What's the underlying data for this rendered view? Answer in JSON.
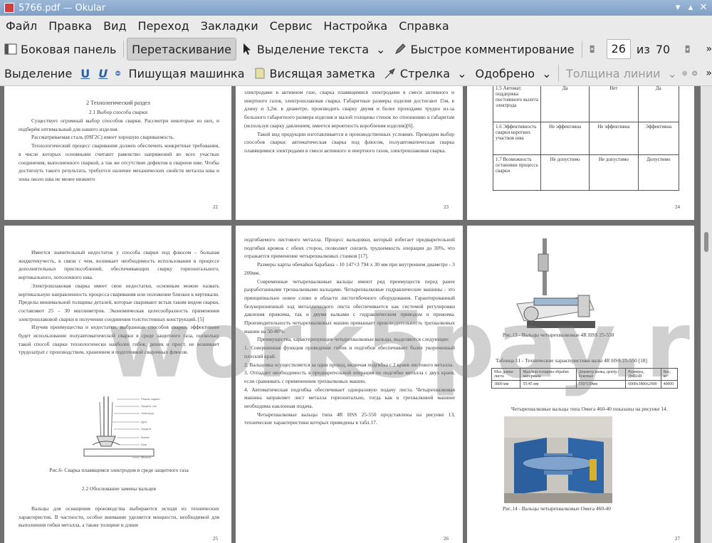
{
  "window": {
    "title": "5766.pdf  — Okular"
  },
  "menu": [
    "Файл",
    "Правка",
    "Вид",
    "Переход",
    "Закладки",
    "Сервис",
    "Настройка",
    "Справка"
  ],
  "toolbar1": {
    "sidebar": "Боковая панель",
    "drag": "Перетаскивание",
    "text_select": "Выделение текста",
    "quick_comment": "Быстрое комментирование",
    "current_page": "26",
    "of_label": "из",
    "total_pages": "70"
  },
  "toolbar2": {
    "highlight": "Выделение",
    "typewriter": "Пишущая машинка",
    "sticky_note": "Висящая заметка",
    "arrow": "Стрелка",
    "approved": "Одобрено",
    "line_width": "Толщина линии"
  },
  "watermark": "work5pay.ru",
  "pages": {
    "p22": {
      "number": "22",
      "heading": "2 Технологический раздел",
      "subheading": "2.1 Выбор способа сварки",
      "paragraphs": [
        "Существует огромный выбор способов сварки. Рассмотри некоторые из них, и подберём оптимальный для нашего изделия.",
        "Рассматриваемая сталь (09Г2С) имеет хорошую свариваемость.",
        "Технологический процесс сваривания должен обеспечить конкретные требования, в числе которых основными считают равенство напряжений во всех участках соединения, выполненного сваркой, а так же отсутствие дефектов в сварном шве. Чтобы достигнуть такого результата, требуется наличие механических свойств металла шва и зоны около шва не менее нижнего"
      ]
    },
    "p23": {
      "number": "23",
      "paragraphs": [
        "электродами в активном газе, сварка плавящимися электродами в смеси активного и инертного газов, электрошлаковая сварка. Габаритные размеры изделия достигают 15м, в длину и 3,2м. в диаметре, производить сварку двумя и более проходами трудно из-за большого габаритного размера изделия и малой толщины стенок по отношению к габаритам (используя сварку давлением, имеется вероятность коробления изделия)[6].",
        "Такой вид продукции изготавливается в производственных условиях. Проводим выбор способов сварки: автоматическая сварка под флюсом, полуавтоматическая сварка плавящимися электродами в смеси активного и инертного газов, электрошлаковая сварка."
      ]
    },
    "p24": {
      "number": "24",
      "table": [
        [
          "1.5 Автомат. поддержка постоянного вылета электрода",
          "Да",
          "Нет",
          "Да"
        ],
        [
          "1.6 Эффективность сварки коротких участков шва",
          "Не эффективна",
          "Не эффективна",
          "Эффективна"
        ],
        [
          "1.7 Возможность остановки процесса сварки",
          "Не допустимо",
          "Не допустимо",
          "Допустимо"
        ]
      ]
    },
    "p25": {
      "number": "25",
      "paragraphs": [
        "Имеется значительный недостаток у способа сварки под флюсом – большая жидкотекучесть, в связи с чем, возникает необходимость использования в процессе дополнительных приспособлений, обеспечивающих сварку горизонтального, вертикального, потолочного шва.",
        "Электрошлаковая сварка имеет свои недостатки, основным можно назвать вертикальную направленность процесса сваривания или положение близкое к вертикали. Пределы минимальной толщины деталей, которые сваривают встык таким видом сварки, составляют 25 – 30 миллиметров. Экономическая целесообразность применения электрошлаковой сварки в получении соединения толстостенных конструкций. [5]",
        "Изучив преимущества и недостатки, выбранных способов сварки, эффективнее будет использование полуавтоматической сварки в среде защитного газа, поскольку такой способ сварки технологически наиболее гибок, дешев и прост, не возникает трудозатрат с производством, хранением и подготовкой сварочных флюсов."
      ],
      "caption": "Рис.6- Сварка плавящимся электродом в среде защитного газа",
      "subheading": "2.2 Обоснование замены вальцев",
      "bottom": "Вальцы для оснащения производства выбираются исходя из технических характеристик. В частности, особое внимание уделяется мощности, необходимой для выполнения гибки металла, а также толщине и длине"
    },
    "p26": {
      "number": "26",
      "paragraphs": [
        "подгибаемого листового металла. Процесс вальцовки, который избегает предварительной подгибки кромок с обеих сторон, позволяет снизить трудоемкость операции до 30%, что отражается применение четырехвалковых станков [17].",
        "Размеры карты обечайки барабана - 10 147×3 794 х 30 мм при внутреннем диаметре - 3 200мм.",
        "Современные четырехвалковые вальцы имеют ряд преимуществ перед ранее разработанными трехвалковыми вальцами. Четырехвалковые гидравлические машины - это принципиально новое слово в области листогибочного оборудования. Гарантированный безукоризненный ход металлического листа обеспечивается как системой регулировки давления прижима, так и двумя валками с гидравлическим приводом и прижима. Производительность четырехвалковых машин превышает производительность трехвалковых машин на 50-80%.",
        "Преимущества, характеризующие четырехвалковые вальцы, выделяются следующие:",
        "1. Совершенная функция проведение гибов и подгибов обеспечивает более укороченный плоский край.",
        "2. Вальцовка осуществляется за один проход, включая подгибка с 2 краев листового металла.",
        "3. Отпадает необходимость в предварительной операции по подгибке металла с двух краев, если сравнивать с применением трехвалковых машин.",
        "4. Автоматическая подгибка обеспечивает одноразовую подачу листа. Четырехвалковая машина заправляет лист металла горизонтально, тогда как в трехвалковой машине необходима наклонная подача.",
        "Четырехвалковые вальцы типа 4R HSS 25-550 представлены на рисунке 13, технические характеристики которых приведены в табл.17."
      ]
    },
    "p27": {
      "number": "27",
      "caption13": "Рис.13 - Вальцы четырехвалковые 4R HSS 25-550",
      "table_title": "Таблица 11 - Технические характеристики валы 4R HSS 25-550 [18]",
      "table_head": [
        "Мах длина листа",
        "Мах/мін толщина обрабат. материала",
        "Диаметр валка, центр./ боковые",
        "Размеры, ДхШхВ",
        "Вес, кг"
      ],
      "table_row": [
        "3800 мм",
        "55/45 мм",
        "550/530мм",
        "6000х3800х2900",
        "40000"
      ],
      "text": "Четырехвалковые вальцы типа Омега 460-40 показаны на рисунке 14.",
      "caption14": "Рис.14 - Вальцы четырехвалковые Омега 460-40"
    }
  }
}
